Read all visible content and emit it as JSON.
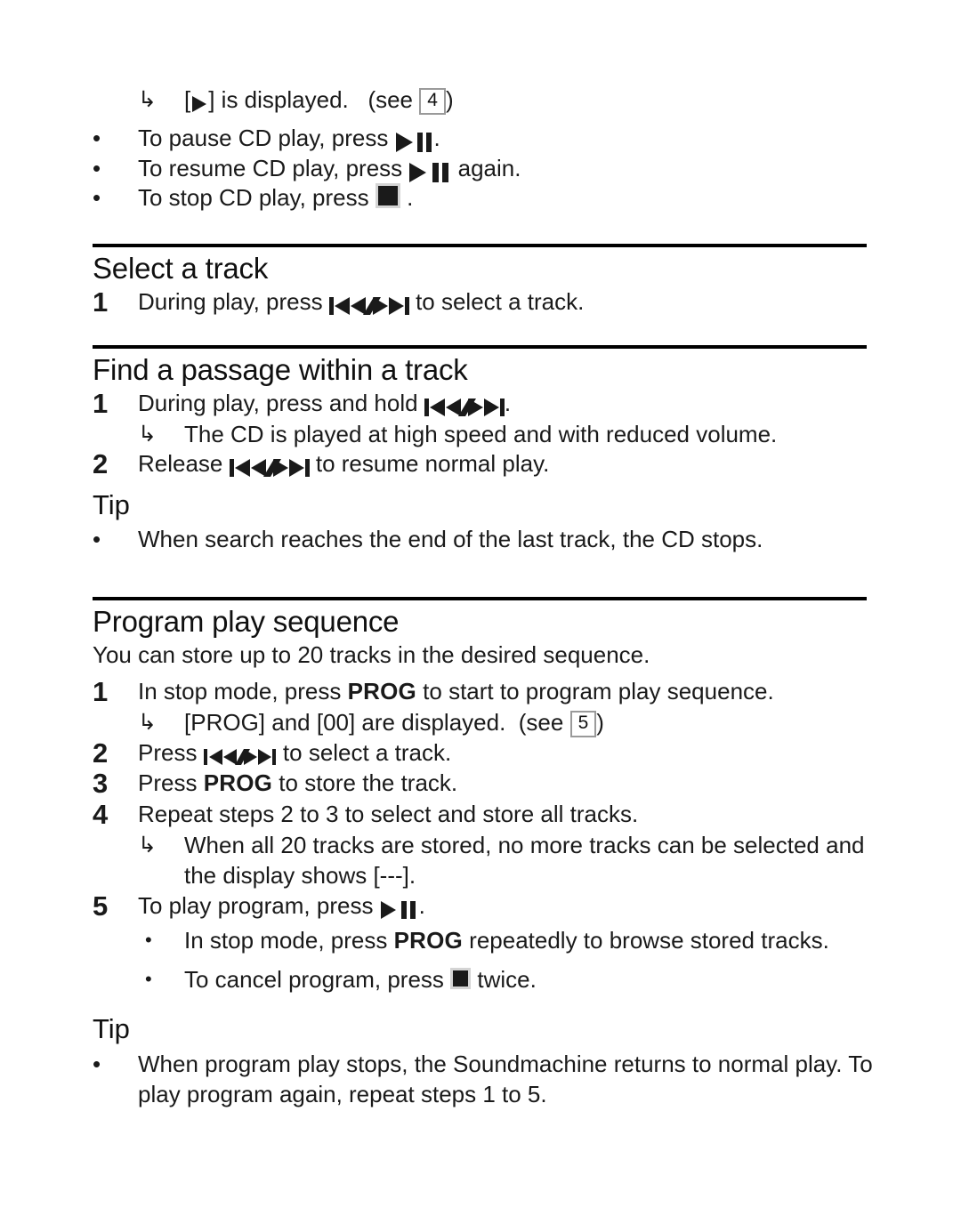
{
  "document": {
    "type": "user-manual-page",
    "language": "en"
  },
  "icons": {
    "play_pause": "play-pause-icon",
    "stop": "stop-icon",
    "skip": "skip-prev-next-icon",
    "arrow": "↳",
    "bullet": "•"
  },
  "top_block": {
    "arrow_line": {
      "prefix": "[",
      "icon": "play-icon",
      "suffix": "] is displayed.",
      "see_label": "(see",
      "see_ref": "4",
      "see_close": ")"
    },
    "bullets": [
      {
        "before": "To pause CD play, press ",
        "icon": "play-pause-icon",
        "after": "."
      },
      {
        "before": "To resume CD play, press ",
        "icon": "play-pause-icon",
        "after": " again."
      },
      {
        "before": "To stop CD play, press ",
        "icon": "stop-icon",
        "after": " ."
      }
    ]
  },
  "select_track": {
    "title": "Select a track",
    "steps": [
      {
        "number": "1",
        "before": "During play, press ",
        "icon": "skip-prev-next-icon",
        "after": " to select a track."
      }
    ]
  },
  "find_passage": {
    "title": "Find a passage within a track",
    "step1": {
      "number": "1",
      "before": "During play, press and hold ",
      "icon": "skip-prev-next-icon",
      "after": "."
    },
    "step1_result": "The CD is played at high speed and with reduced volume.",
    "step2": {
      "number": "2",
      "before": "Release ",
      "icon": "skip-prev-next-icon",
      "after": " to resume normal play."
    },
    "tip_title": "Tip",
    "tip_items": [
      "When search reaches the end of the last track, the CD stops."
    ]
  },
  "program_play": {
    "title": "Program play sequence",
    "intro": "You can store up to 20 tracks in the desired sequence.",
    "step1": {
      "number": "1",
      "before": "In stop mode, press ",
      "keyword": "PROG",
      "after": " to start to program play sequence."
    },
    "step1_result": {
      "text": "[PROG] and [00] are displayed.",
      "see_label": "(see",
      "see_ref": "5",
      "see_close": ")"
    },
    "step2": {
      "number": "2",
      "before": "Press ",
      "icon": "skip-prev-next-icon",
      "after": " to select a track."
    },
    "step3": {
      "number": "3",
      "before": "Press ",
      "keyword": "PROG",
      "after": " to store the track."
    },
    "step4": {
      "number": "4",
      "text": "Repeat steps 2 to 3 to select and store all tracks."
    },
    "step4_result_line1": "When all 20 tracks are stored, no more tracks can be selected and",
    "step4_result_line2": "the display shows [---].",
    "step5": {
      "number": "5",
      "before": "To play program, press ",
      "icon": "play-pause-icon",
      "after": "."
    },
    "step5_bullets": [
      {
        "before": "In stop mode, press ",
        "keyword": "PROG",
        "after": " repeatedly to browse stored tracks."
      },
      {
        "before": "To cancel program, press ",
        "icon": "stop-icon",
        "after": " twice."
      }
    ],
    "tip_title": "Tip",
    "tip_line1": "When program play stops, the Soundmachine returns to normal play. To",
    "tip_line2": "play program again, repeat steps 1 to 5."
  },
  "colors": {
    "text": "#1a1a1a",
    "rule": "#000000",
    "box_border": "#9a9a9a",
    "page_background": "#ffffff"
  }
}
